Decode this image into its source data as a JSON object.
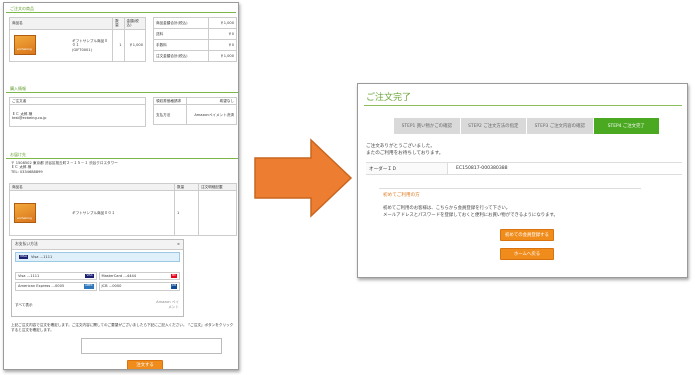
{
  "left": {
    "order_section_title": "ご注文の商品",
    "order_table": {
      "headers": [
        "商品名",
        "数量",
        "金額(税込)"
      ],
      "product_name": "ギフトサンプル商品００１",
      "product_code": "(GIFT0001)",
      "qty": "1",
      "price": "￥1,000",
      "image_label": "archeking"
    },
    "summary": [
      {
        "label": "商品金額合計(税込)",
        "value": "￥1,000"
      },
      {
        "label": "送料",
        "value": "￥0"
      },
      {
        "label": "手数料",
        "value": "￥0"
      },
      {
        "label": "注文金額合計(税込)",
        "value": "￥1,000"
      }
    ],
    "sender_section_title": "購入情報",
    "sender_label": "ご注文者",
    "sender_name": "ＥＣ 太郎 様",
    "sender_email": "test@ecbeing.co.jp",
    "receipt_label": "領収書価格請求",
    "receipt_value": "希望なし",
    "payment_label": "支払方法",
    "payment_value": "Amazonペイメント決済",
    "dest_section_title": "お届け先",
    "dest_address": "〒 1508502 東京都 渋谷区桜丘町２－１５－１ 渋谷クロスタワー",
    "dest_name": "ＥＣ 太郎 様",
    "dest_tel": "TEL: 0334688899",
    "dest_table_headers": [
      "商品名",
      "数量",
      "注文明細記載"
    ],
    "dest_product_name": "ギフトサンプル商品００１",
    "dest_qty": "1",
    "wallet_title": "お支払い方法",
    "wallet_selected": "Visa …1111",
    "wallet_cards": [
      {
        "label": "Visa …1111",
        "brand": "VISA"
      },
      {
        "label": "MasterCard …4444",
        "brand": "MC"
      },
      {
        "label": "American Express …0005",
        "brand": "AMEX"
      },
      {
        "label": "JCB …0000",
        "brand": "JCB"
      }
    ],
    "wallet_show_all": "すべて表示",
    "wallet_powered": "Amazon ペイメント",
    "note_text": "上記ご注文内容で注文を確定します。ご注文内容に関してのご要望がございましたら下記にご記入ください。「ご注文」ボタンをクリックすると注文を確定します。",
    "order_button": "注文する"
  },
  "right": {
    "title": "ご注文完了",
    "steps": [
      {
        "label": "STEP1 買い物かごの確認",
        "active": false
      },
      {
        "label": "STEP2 ご注文方法の指定",
        "active": false
      },
      {
        "label": "STEP3 ご注文内容の確認",
        "active": false
      },
      {
        "label": "STEP4 ご注文完了",
        "active": true
      }
    ],
    "thanks_1": "ご注文ありがとうございました。",
    "thanks_2": "またのご利用をお待ちしております。",
    "order_id_label": "オーダーＩＤ",
    "order_id_value": "EC150817-000380388",
    "first_title": "初めてご利用の方",
    "first_msg_1": "初めてご利用のお客様は、こちらから会員登録を行って下さい。",
    "first_msg_2": "メールアドレスとパスワードを登録しておくと便利にお買い物ができるようになります。",
    "register_button": "初めての会員登録する",
    "home_button": "ホームへ戻る"
  },
  "colors": {
    "accent_green": "#4aa821",
    "accent_orange": "#f08c1c",
    "arrow": "#ed7d31"
  }
}
